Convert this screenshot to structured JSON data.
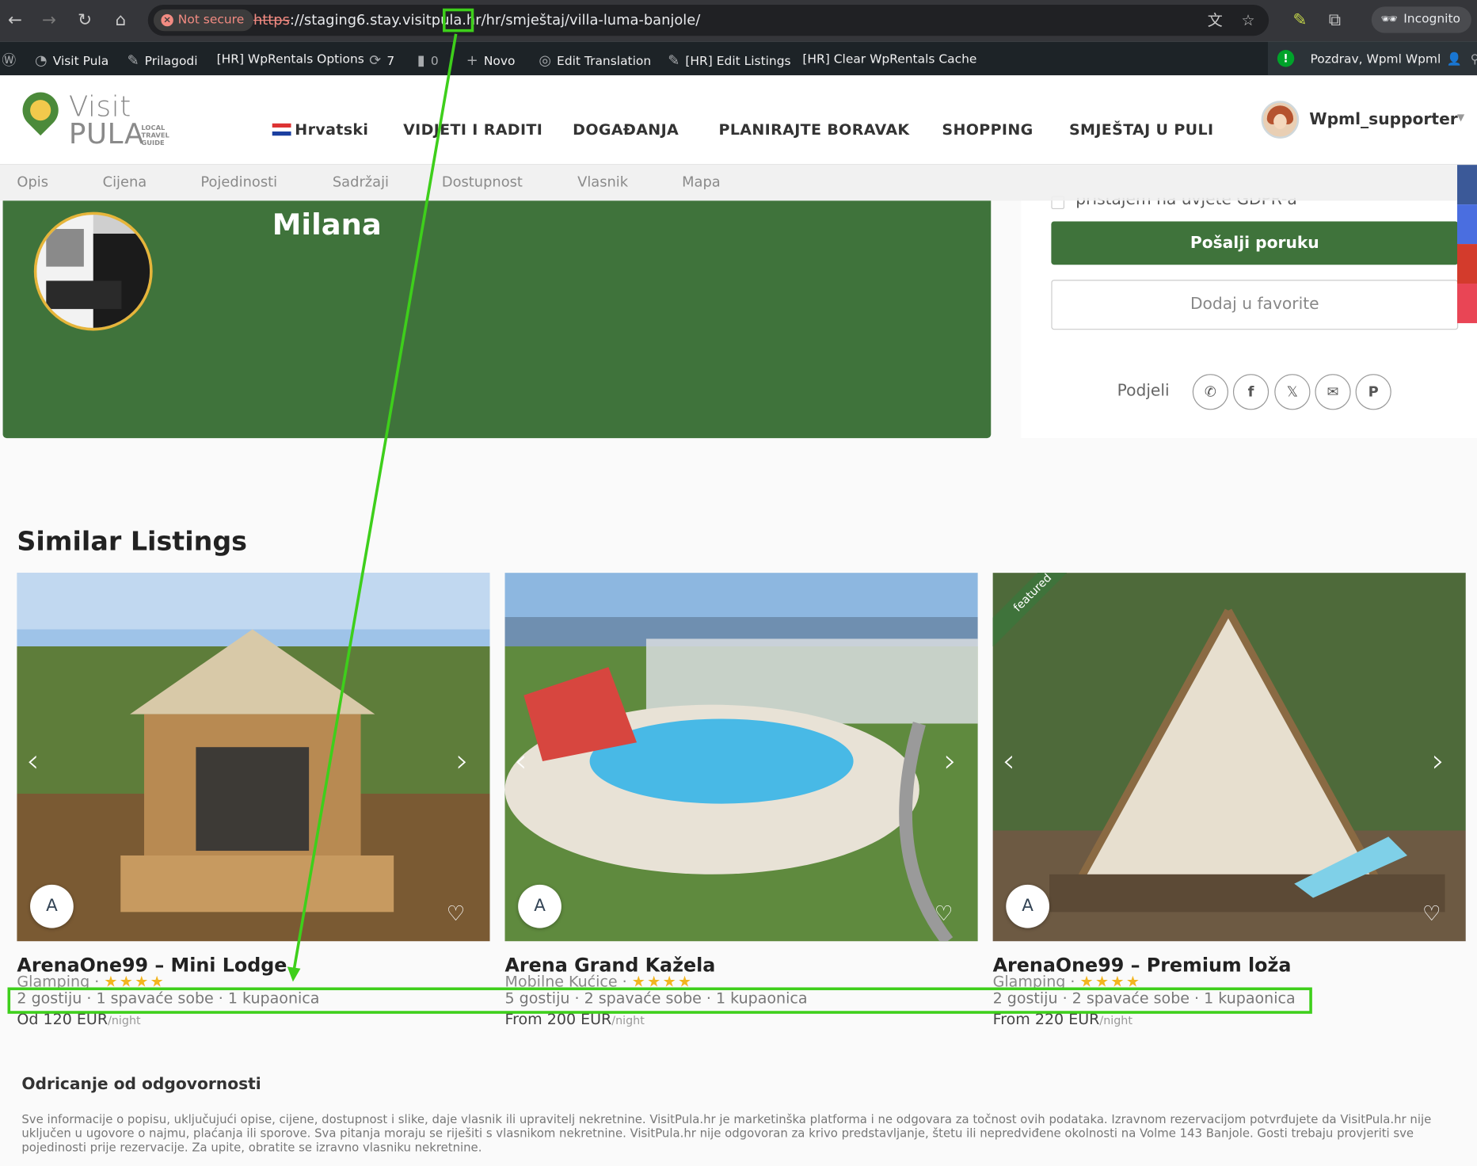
{
  "browser": {
    "not_secure": "Not secure",
    "url_scheme": "https",
    "url_rest": "://staging6.stay.visitpula.hr/hr/smještaj/villa-luma-banjole/",
    "incognito": "Incognito"
  },
  "adminbar": {
    "site": "Visit Pula",
    "customize": "Prilagodi",
    "wprentals_options": "[HR] WpRentals Options",
    "updates": "7",
    "comments": "0",
    "new": "Novo",
    "edit_translation": "Edit Translation",
    "edit_listings": "[HR] Edit Listings",
    "clear_cache": "[HR] Clear WpRentals Cache",
    "greeting": "Pozdrav, Wpml Wpml"
  },
  "header": {
    "logo_visit": "Visit",
    "logo_pula": "PULA",
    "logo_tag": [
      "LOCAL",
      "TRAVEL",
      "GUIDE"
    ],
    "language": "Hrvatski",
    "menu": [
      "VIDJETI I RADITI",
      "DOGAĐANJA",
      "PLANIRAJTE BORAVAK",
      "SHOPPING",
      "SMJEŠTAJ U PULI"
    ],
    "user": "Wpml_supporter"
  },
  "subtabs": [
    "Opis",
    "Cijena",
    "Pojedinosti",
    "Sadržaji",
    "Dostupnost",
    "Vlasnik",
    "Mapa"
  ],
  "hero": {
    "name": "Milana"
  },
  "sidebar": {
    "gdpr": "pristajem na uvjete GDPR-a",
    "send": "Pošalji poruku",
    "favorite": "Dodaj u favorite",
    "share_label": "Podjeli"
  },
  "similar": {
    "title": "Similar Listings",
    "cards": [
      {
        "title": "ArenaOne99 – Mini Lodge",
        "type": "Glamping ·",
        "stars": "★★★★",
        "details": "2 gostiju · 1 spavaće sobe · 1 kupaonica",
        "price": "Od 120 EUR",
        "unit": "/night",
        "featured": ""
      },
      {
        "title": "Arena Grand Kažela",
        "type": "Mobilne Kućice ·",
        "stars": "★★★★",
        "details": "5 gostiju · 2 spavaće sobe · 1 kupaonica",
        "price": "From 200 EUR",
        "unit": "/night",
        "featured": ""
      },
      {
        "title": "ArenaOne99 – Premium loža",
        "type": "Glamping ·",
        "stars": "★★★★",
        "details": "2 gostiju · 2 spavaće sobe · 1 kupaonica",
        "price": "From 220 EUR",
        "unit": "/night",
        "featured": "featured"
      }
    ]
  },
  "disclaimer": {
    "title": "Odricanje od odgovornosti",
    "text": "Sve informacije o popisu, uključujući opise, cijene, dostupnost i slike, daje vlasnik ili upravitelj nekretnine. VisitPula.hr je marketinška platforma i ne odgovara za točnost ovih podataka. Izravnom rezervacijom potvrđujete da VisitPula.hr nije uključen u ugovore o najmu, plaćanja ili sporove. Sva pitanja moraju se riješiti s vlasnikom nekretnine. VisitPula.hr nije odgovoran za krivo predstavljanje, štetu ili nepredviđene okolnosti na Volme 143 Banjole. Gosti trebaju provjeriti sve pojedinosti prije rezervacije. Za upite, obratite se izravno vlasniku nekretnine."
  },
  "colors": {
    "brand_green": "#3f733b",
    "annotation_green": "#3ecf1b",
    "star": "#f2b51f"
  }
}
